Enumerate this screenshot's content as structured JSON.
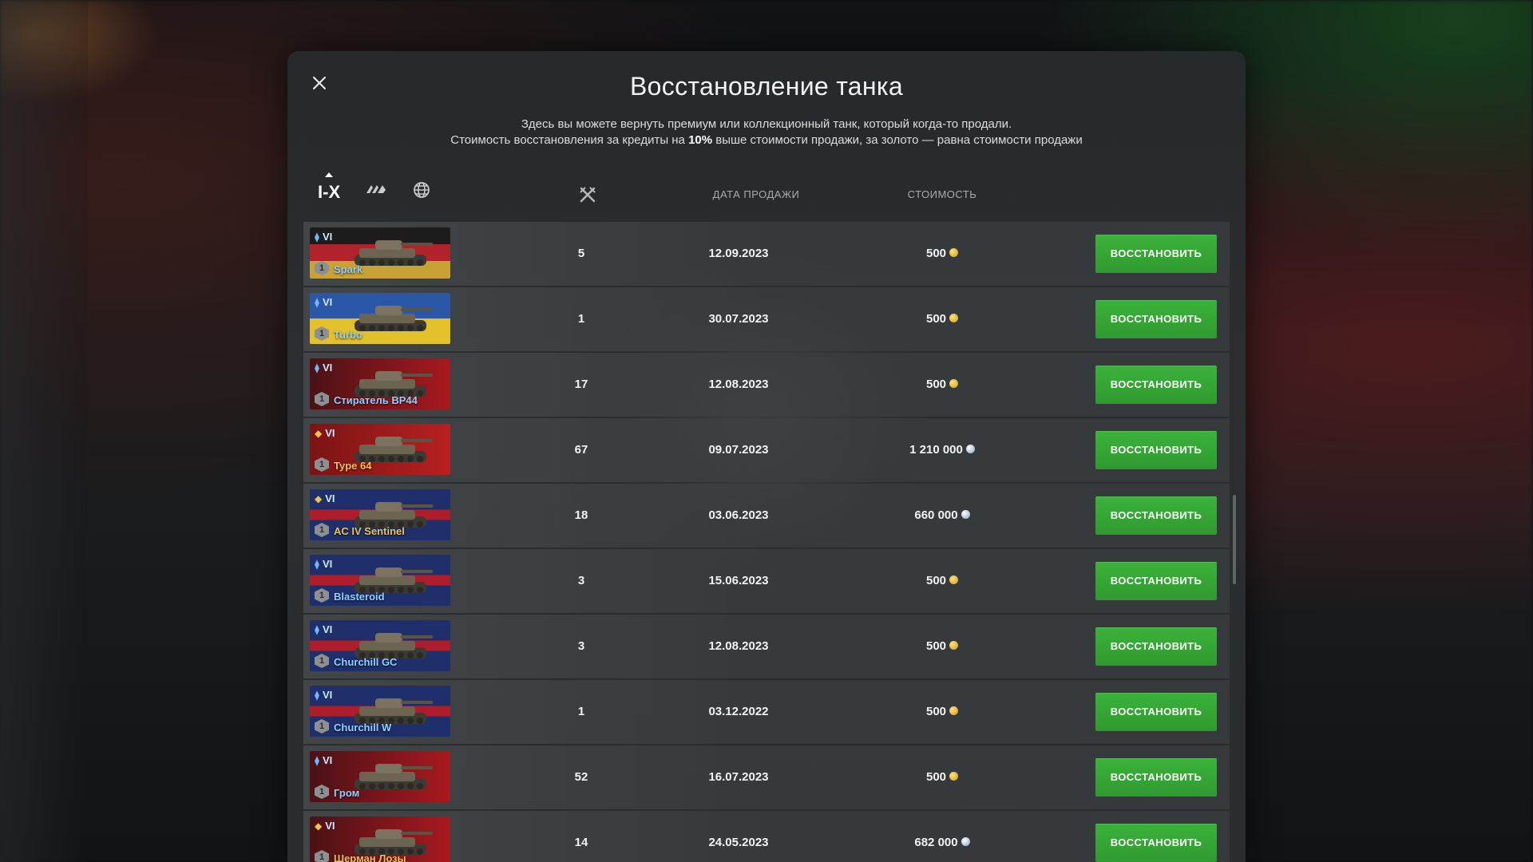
{
  "dialog": {
    "title": "Восстановление танка",
    "subtitle_line1": "Здесь вы можете вернуть премиум или коллекционный танк, который когда-то продали.",
    "subtitle_line2_a": "Стоимость восстановления за кредиты на ",
    "subtitle_line2_bold": "10%",
    "subtitle_line2_b": " выше стоимости продажи, за золото — равна стоимости продажи"
  },
  "filters": {
    "tier_label": "I-X"
  },
  "columns": {
    "date": "ДАТА ПРОДАЖИ",
    "price": "СТОИМОСТЬ"
  },
  "colors": {
    "restore_button": "#34a534",
    "gold": "#f0c24a",
    "collectible_name": "#8fd0ff"
  },
  "rows": [
    {
      "tier": "VI",
      "name": "Spark",
      "battles": "5",
      "date": "12.09.2023",
      "price": "500",
      "currency": "gold",
      "flag": "germany",
      "kind": "collectible",
      "button": "ВОССТАНОВИТЬ"
    },
    {
      "tier": "VI",
      "name": "Turbo",
      "battles": "1",
      "date": "30.07.2023",
      "price": "500",
      "currency": "gold",
      "flag": "ukraine",
      "kind": "collectible",
      "button": "ВОССТАНОВИТЬ"
    },
    {
      "tier": "VI",
      "name": "Стиратель BP44",
      "battles": "17",
      "date": "12.08.2023",
      "price": "500",
      "currency": "gold",
      "flag": "ussr",
      "kind": "collectible",
      "button": "ВОССТАНОВИТЬ"
    },
    {
      "tier": "VI",
      "name": "Type 64",
      "battles": "67",
      "date": "09.07.2023",
      "price": "1 210 000",
      "currency": "silver",
      "flag": "china",
      "kind": "premium",
      "button": "ВОССТАНОВИТЬ"
    },
    {
      "tier": "VI",
      "name": "AC IV Sentinel",
      "battles": "18",
      "date": "03.06.2023",
      "price": "660 000",
      "currency": "silver",
      "flag": "uk",
      "kind": "premium",
      "button": "ВОССТАНОВИТЬ"
    },
    {
      "tier": "VI",
      "name": "Blasteroid",
      "battles": "3",
      "date": "15.06.2023",
      "price": "500",
      "currency": "gold",
      "flag": "uk",
      "kind": "collectible",
      "button": "ВОССТАНОВИТЬ"
    },
    {
      "tier": "VI",
      "name": "Churchill GC",
      "battles": "3",
      "date": "12.08.2023",
      "price": "500",
      "currency": "gold",
      "flag": "uk",
      "kind": "collectible",
      "button": "ВОССТАНОВИТЬ"
    },
    {
      "tier": "VI",
      "name": "Churchill W",
      "battles": "1",
      "date": "03.12.2022",
      "price": "500",
      "currency": "gold",
      "flag": "uk",
      "kind": "collectible",
      "button": "ВОССТАНОВИТЬ"
    },
    {
      "tier": "VI",
      "name": "Гром",
      "battles": "52",
      "date": "16.07.2023",
      "price": "500",
      "currency": "gold",
      "flag": "ussr",
      "kind": "collectible",
      "button": "ВОССТАНОВИТЬ"
    },
    {
      "tier": "VI",
      "name": "Шерман Лозы",
      "battles": "14",
      "date": "24.05.2023",
      "price": "682 000",
      "currency": "silver",
      "flag": "ussr",
      "kind": "premium",
      "button": "ВОССТАНОВИТЬ"
    }
  ]
}
